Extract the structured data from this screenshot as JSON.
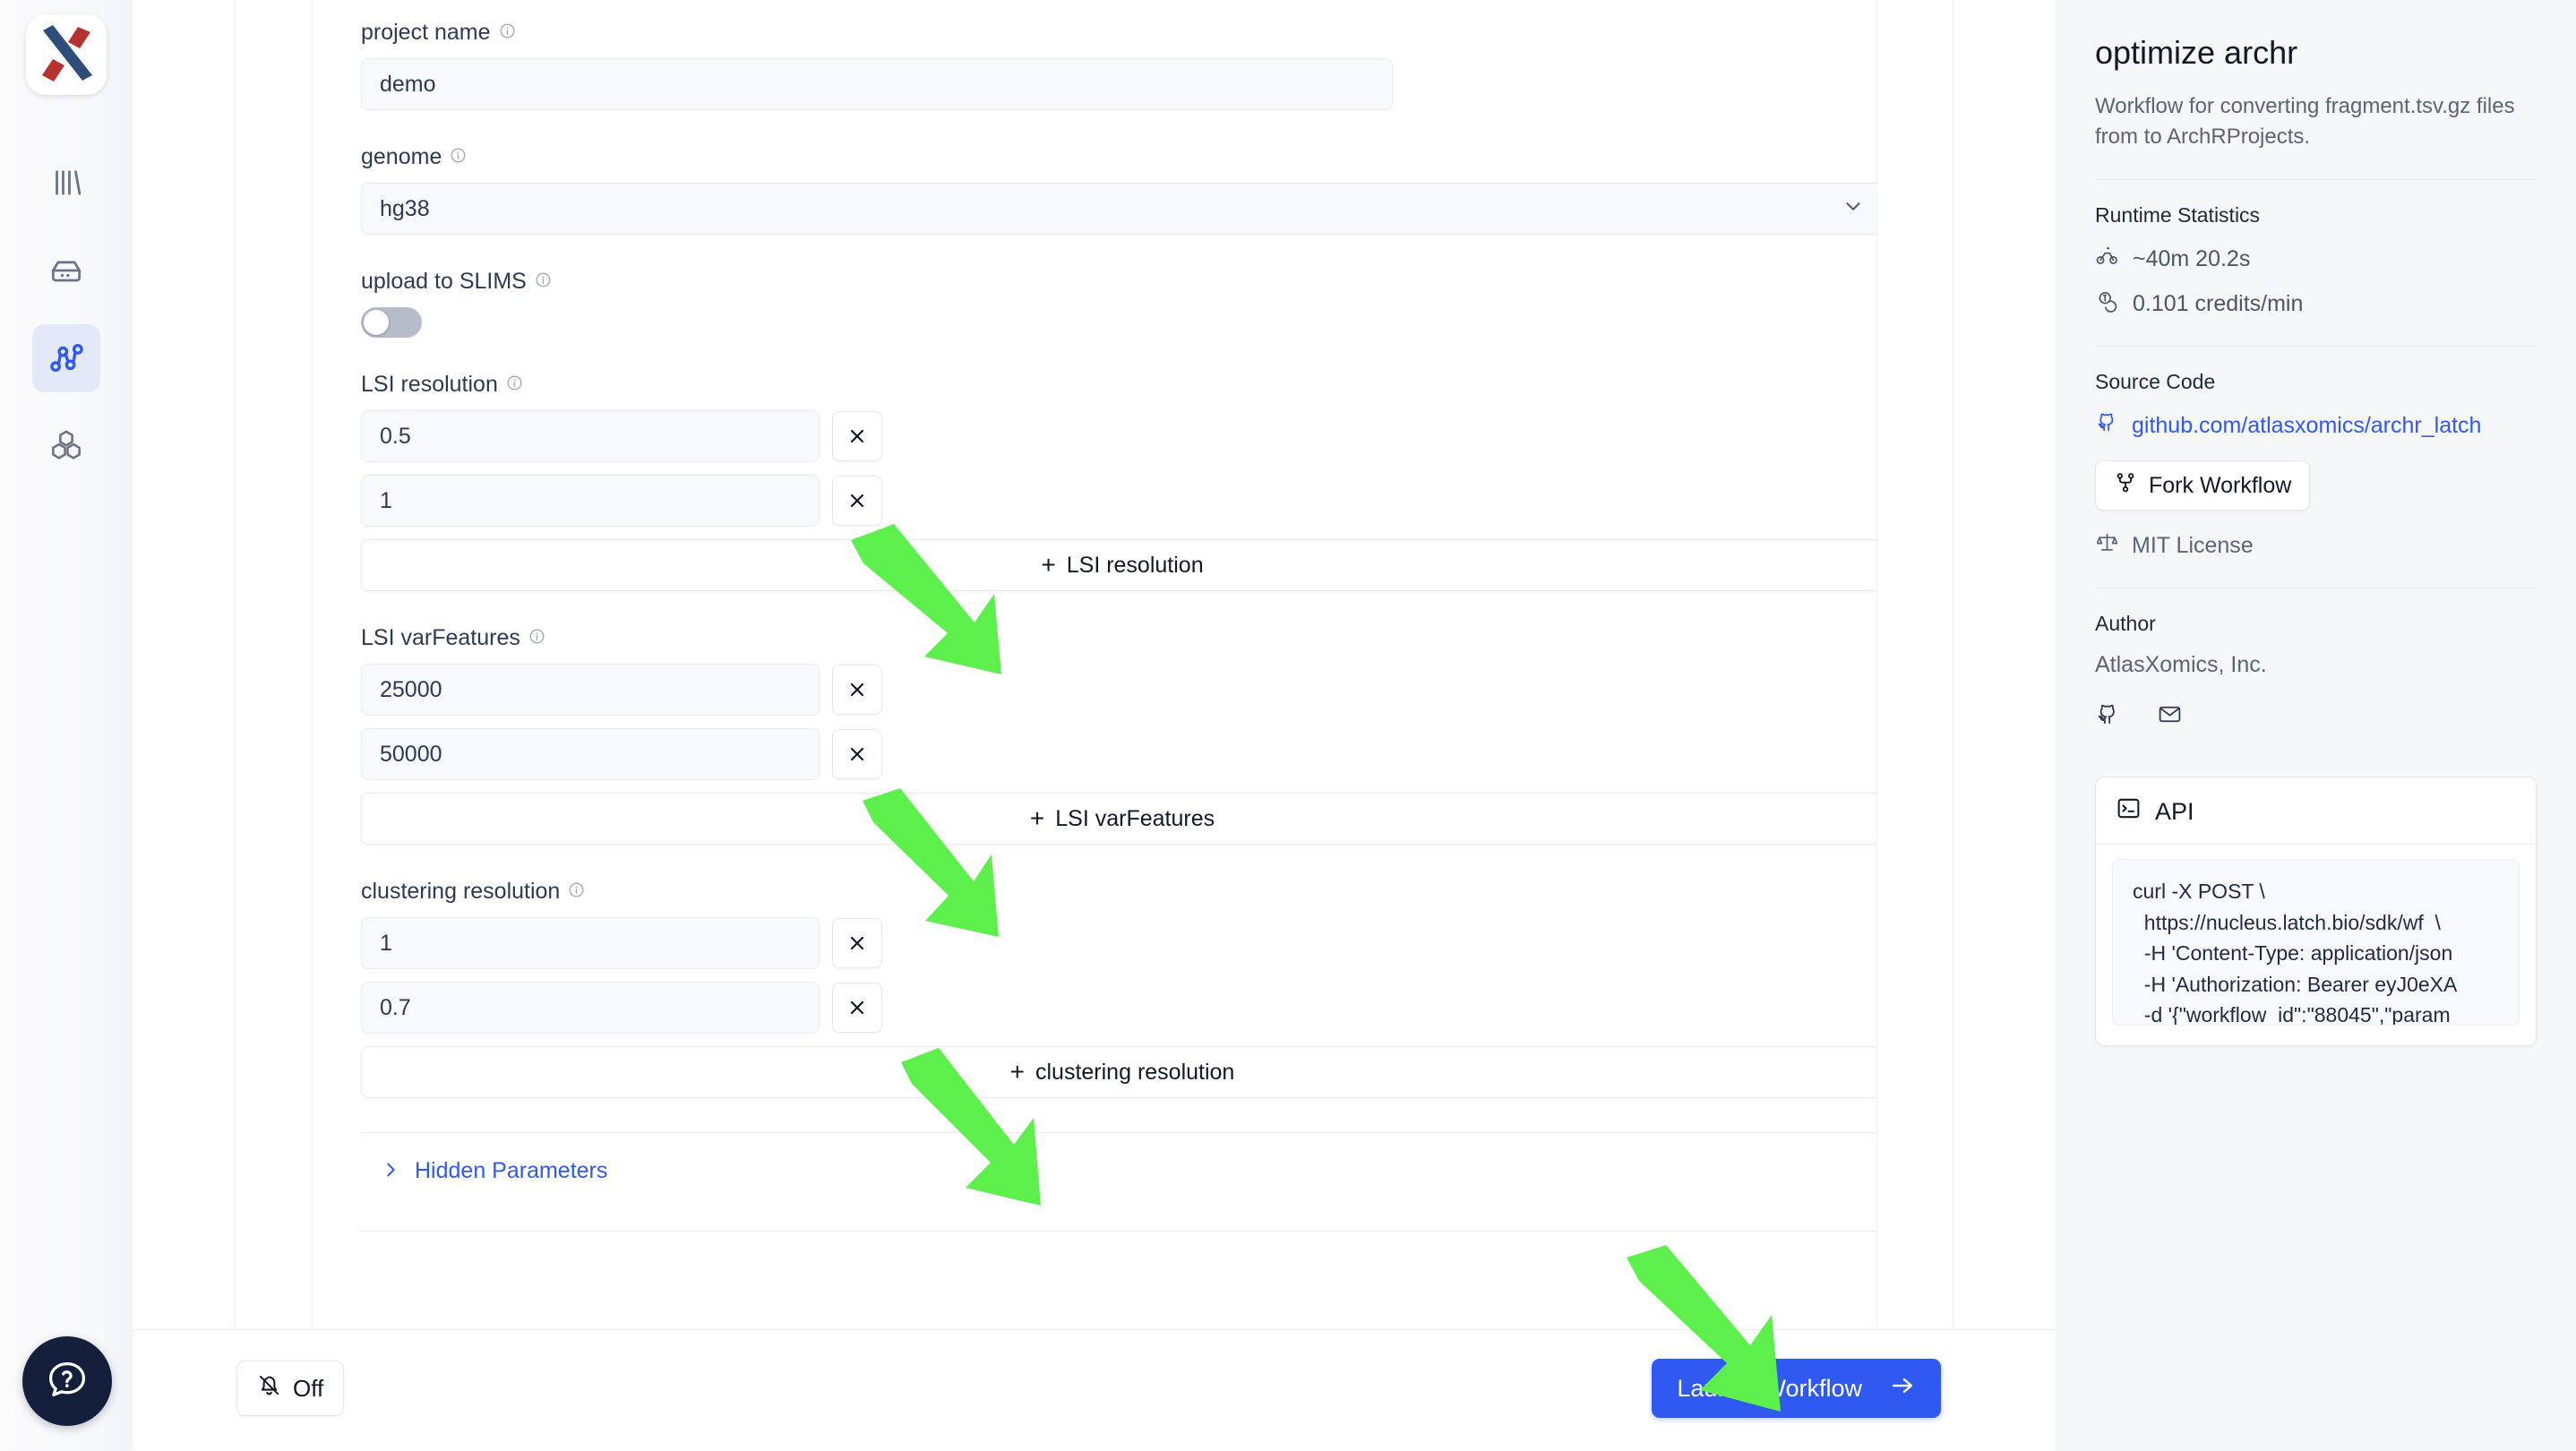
{
  "brand": {
    "logo_name": "atlasxomics-logo"
  },
  "sidebar": {
    "items": [
      {
        "name": "sidebar-item-data",
        "icon": "bars-chart-icon",
        "active": false
      },
      {
        "name": "sidebar-item-pods",
        "icon": "server-icon",
        "active": false
      },
      {
        "name": "sidebar-item-workflows",
        "icon": "workflow-graph-icon",
        "active": true
      },
      {
        "name": "sidebar-item-registry",
        "icon": "hexagons-icon",
        "active": false
      }
    ]
  },
  "help": {
    "icon": "question-chat-icon"
  },
  "form": {
    "project_name": {
      "label": "project name",
      "value": "demo",
      "placeholder": "project name",
      "info_icon": "info-circle-icon"
    },
    "genome": {
      "label": "genome",
      "value": "hg38",
      "info_icon": "info-circle-icon",
      "chevron_icon": "chevron-down-icon",
      "options": [
        "hg38"
      ]
    },
    "upload_to_slims": {
      "label": "upload to SLIMS",
      "info_icon": "info-circle-icon",
      "enabled": false
    },
    "lsi_resolution": {
      "label": "LSI resolution",
      "info_icon": "info-circle-icon",
      "values": [
        "0.5",
        "1"
      ],
      "remove_icon": "close-x-icon",
      "add_label": "LSI resolution",
      "add_plus": "+"
    },
    "lsi_varfeatures": {
      "label": "LSI varFeatures",
      "info_icon": "info-circle-icon",
      "values": [
        "25000",
        "50000"
      ],
      "remove_icon": "close-x-icon",
      "add_label": "LSI varFeatures",
      "add_plus": "+"
    },
    "clustering_resolution": {
      "label": "clustering resolution",
      "info_icon": "info-circle-icon",
      "values": [
        "1",
        "0.7"
      ],
      "remove_icon": "close-x-icon",
      "add_label": "clustering resolution",
      "add_plus": "+"
    },
    "hidden_parameters": {
      "label": "Hidden Parameters",
      "chevron_icon": "chevron-right-icon",
      "expanded": false,
      "color": "#2f59f0"
    }
  },
  "bottom_bar": {
    "notifications": {
      "label": "Off",
      "icon": "bell-off-icon"
    },
    "launch": {
      "label": "Launch Workflow",
      "icon": "arrow-right-icon",
      "color": "#2f59f0"
    }
  },
  "info_panel": {
    "title": "optimize archr",
    "description": "Workflow for converting fragment.tsv.gz files from to ArchRProjects.",
    "runtime": {
      "heading": "Runtime Statistics",
      "duration": "~40m 20.2s",
      "duration_icon": "bike-icon",
      "credits": "0.101 credits/min",
      "credits_icon": "coins-icon"
    },
    "source_code": {
      "heading": "Source Code",
      "repo": "github.com/atlasxomics/archr_latch",
      "repo_icon": "github-icon",
      "fork_label": "Fork Workflow",
      "fork_icon": "fork-icon",
      "license": "MIT License",
      "license_icon": "scales-icon"
    },
    "author": {
      "heading": "Author",
      "name": "AtlasXomics, Inc.",
      "icons": [
        "github-icon",
        "mail-icon"
      ]
    },
    "api": {
      "heading": "API",
      "icon": "terminal-icon",
      "code": "curl -X POST \\\n  https://nucleus.latch.bio/sdk/wf  \\\n  -H 'Content-Type: application/json\n  -H 'Authorization: Bearer eyJ0eXA\n  -d '{\"workflow_id\":\"88045\",\"param"
    }
  },
  "annotations": {
    "color": "#5df04d",
    "arrows": [
      {
        "name": "arrow-to-add-lsi-resolution"
      },
      {
        "name": "arrow-to-add-lsi-varfeatures"
      },
      {
        "name": "arrow-to-add-clustering-resolution"
      },
      {
        "name": "arrow-to-launch-workflow"
      }
    ]
  }
}
